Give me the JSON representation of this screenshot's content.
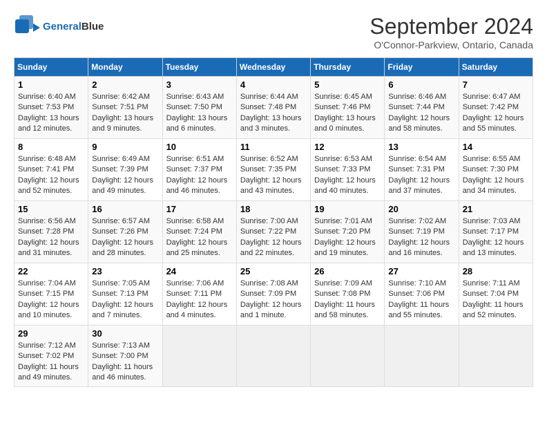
{
  "header": {
    "logo_general": "General",
    "logo_blue": "Blue",
    "month": "September 2024",
    "location": "O'Connor-Parkview, Ontario, Canada"
  },
  "weekdays": [
    "Sunday",
    "Monday",
    "Tuesday",
    "Wednesday",
    "Thursday",
    "Friday",
    "Saturday"
  ],
  "weeks": [
    [
      {
        "day": "1",
        "sunrise": "6:40 AM",
        "sunset": "7:53 PM",
        "daylight": "13 hours and 12 minutes."
      },
      {
        "day": "2",
        "sunrise": "6:42 AM",
        "sunset": "7:51 PM",
        "daylight": "13 hours and 9 minutes."
      },
      {
        "day": "3",
        "sunrise": "6:43 AM",
        "sunset": "7:50 PM",
        "daylight": "13 hours and 6 minutes."
      },
      {
        "day": "4",
        "sunrise": "6:44 AM",
        "sunset": "7:48 PM",
        "daylight": "13 hours and 3 minutes."
      },
      {
        "day": "5",
        "sunrise": "6:45 AM",
        "sunset": "7:46 PM",
        "daylight": "13 hours and 0 minutes."
      },
      {
        "day": "6",
        "sunrise": "6:46 AM",
        "sunset": "7:44 PM",
        "daylight": "12 hours and 58 minutes."
      },
      {
        "day": "7",
        "sunrise": "6:47 AM",
        "sunset": "7:42 PM",
        "daylight": "12 hours and 55 minutes."
      }
    ],
    [
      {
        "day": "8",
        "sunrise": "6:48 AM",
        "sunset": "7:41 PM",
        "daylight": "12 hours and 52 minutes."
      },
      {
        "day": "9",
        "sunrise": "6:49 AM",
        "sunset": "7:39 PM",
        "daylight": "12 hours and 49 minutes."
      },
      {
        "day": "10",
        "sunrise": "6:51 AM",
        "sunset": "7:37 PM",
        "daylight": "12 hours and 46 minutes."
      },
      {
        "day": "11",
        "sunrise": "6:52 AM",
        "sunset": "7:35 PM",
        "daylight": "12 hours and 43 minutes."
      },
      {
        "day": "12",
        "sunrise": "6:53 AM",
        "sunset": "7:33 PM",
        "daylight": "12 hours and 40 minutes."
      },
      {
        "day": "13",
        "sunrise": "6:54 AM",
        "sunset": "7:31 PM",
        "daylight": "12 hours and 37 minutes."
      },
      {
        "day": "14",
        "sunrise": "6:55 AM",
        "sunset": "7:30 PM",
        "daylight": "12 hours and 34 minutes."
      }
    ],
    [
      {
        "day": "15",
        "sunrise": "6:56 AM",
        "sunset": "7:28 PM",
        "daylight": "12 hours and 31 minutes."
      },
      {
        "day": "16",
        "sunrise": "6:57 AM",
        "sunset": "7:26 PM",
        "daylight": "12 hours and 28 minutes."
      },
      {
        "day": "17",
        "sunrise": "6:58 AM",
        "sunset": "7:24 PM",
        "daylight": "12 hours and 25 minutes."
      },
      {
        "day": "18",
        "sunrise": "7:00 AM",
        "sunset": "7:22 PM",
        "daylight": "12 hours and 22 minutes."
      },
      {
        "day": "19",
        "sunrise": "7:01 AM",
        "sunset": "7:20 PM",
        "daylight": "12 hours and 19 minutes."
      },
      {
        "day": "20",
        "sunrise": "7:02 AM",
        "sunset": "7:19 PM",
        "daylight": "12 hours and 16 minutes."
      },
      {
        "day": "21",
        "sunrise": "7:03 AM",
        "sunset": "7:17 PM",
        "daylight": "12 hours and 13 minutes."
      }
    ],
    [
      {
        "day": "22",
        "sunrise": "7:04 AM",
        "sunset": "7:15 PM",
        "daylight": "12 hours and 10 minutes."
      },
      {
        "day": "23",
        "sunrise": "7:05 AM",
        "sunset": "7:13 PM",
        "daylight": "12 hours and 7 minutes."
      },
      {
        "day": "24",
        "sunrise": "7:06 AM",
        "sunset": "7:11 PM",
        "daylight": "12 hours and 4 minutes."
      },
      {
        "day": "25",
        "sunrise": "7:08 AM",
        "sunset": "7:09 PM",
        "daylight": "12 hours and 1 minute."
      },
      {
        "day": "26",
        "sunrise": "7:09 AM",
        "sunset": "7:08 PM",
        "daylight": "11 hours and 58 minutes."
      },
      {
        "day": "27",
        "sunrise": "7:10 AM",
        "sunset": "7:06 PM",
        "daylight": "11 hours and 55 minutes."
      },
      {
        "day": "28",
        "sunrise": "7:11 AM",
        "sunset": "7:04 PM",
        "daylight": "11 hours and 52 minutes."
      }
    ],
    [
      {
        "day": "29",
        "sunrise": "7:12 AM",
        "sunset": "7:02 PM",
        "daylight": "11 hours and 49 minutes."
      },
      {
        "day": "30",
        "sunrise": "7:13 AM",
        "sunset": "7:00 PM",
        "daylight": "11 hours and 46 minutes."
      },
      null,
      null,
      null,
      null,
      null
    ]
  ],
  "labels": {
    "sunrise": "Sunrise:",
    "sunset": "Sunset:",
    "daylight": "Daylight:"
  }
}
